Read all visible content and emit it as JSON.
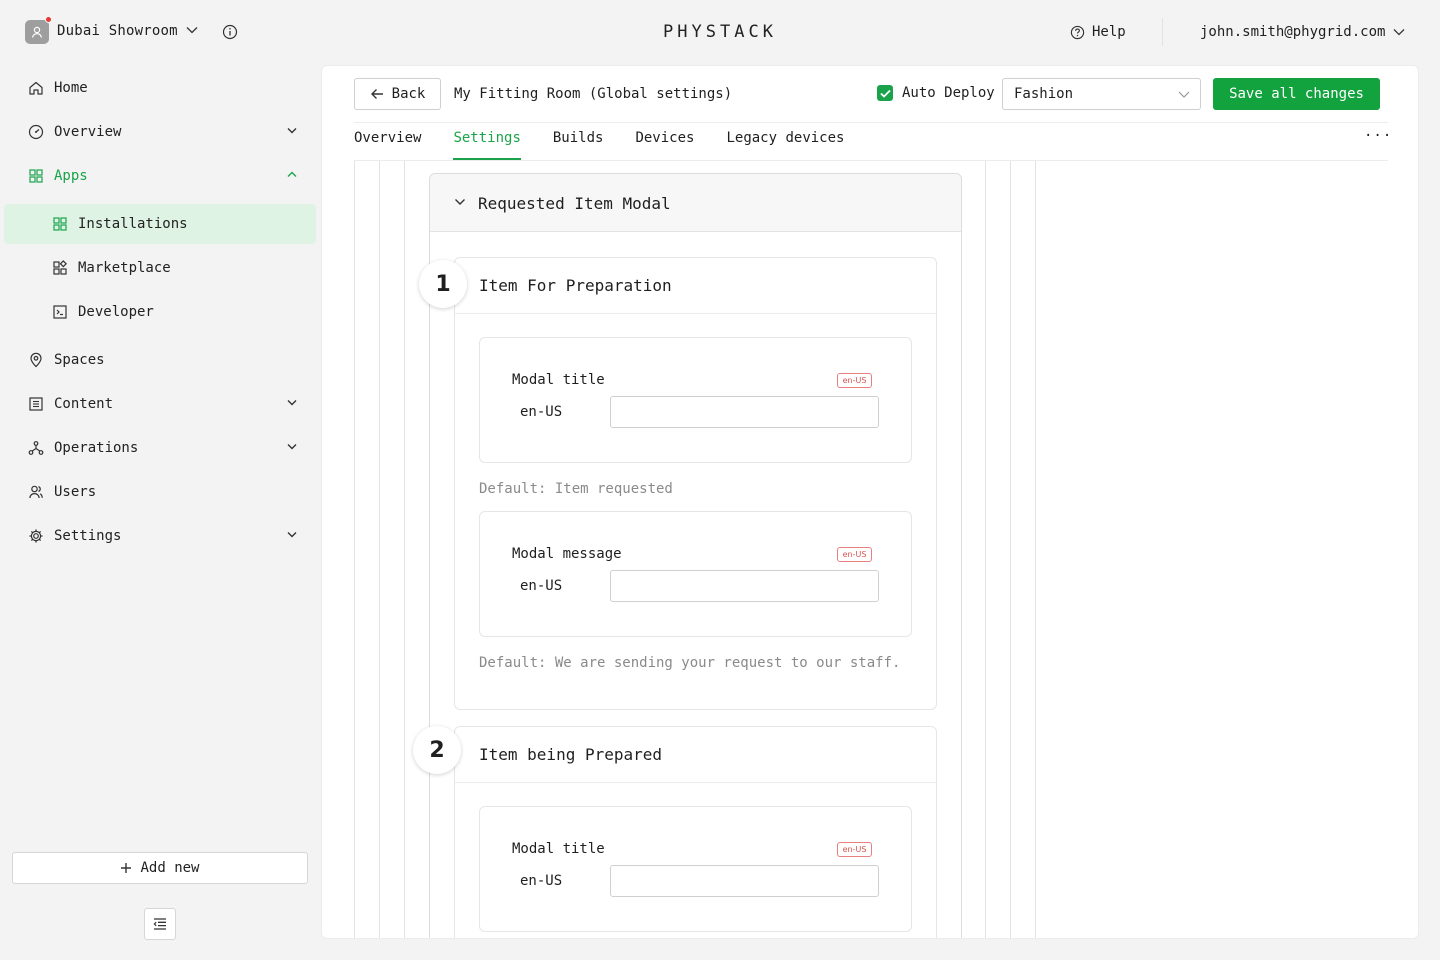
{
  "workspace": {
    "name": "Dubai Showroom"
  },
  "logo": "PHYSTACK",
  "header": {
    "help_label": "Help",
    "user_email": "john.smith@phygrid.com"
  },
  "sidebar": {
    "items": [
      {
        "label": "Home"
      },
      {
        "label": "Overview"
      },
      {
        "label": "Apps"
      },
      {
        "label": "Installations"
      },
      {
        "label": "Marketplace"
      },
      {
        "label": "Developer"
      },
      {
        "label": "Spaces"
      },
      {
        "label": "Content"
      },
      {
        "label": "Operations"
      },
      {
        "label": "Users"
      },
      {
        "label": "Settings"
      }
    ],
    "add_new_label": "Add new"
  },
  "toolbar": {
    "back_label": "Back",
    "title": "My Fitting Room (Global settings)",
    "auto_deploy_label": "Auto Deploy",
    "auto_deploy_checked": true,
    "select_value": "Fashion",
    "save_label": "Save all changes"
  },
  "tabs": [
    {
      "label": "Overview"
    },
    {
      "label": "Settings",
      "active": true
    },
    {
      "label": "Builds"
    },
    {
      "label": "Devices"
    },
    {
      "label": "Legacy devices"
    }
  ],
  "tabs_more": "···",
  "section": {
    "title": "Requested Item Modal",
    "steps": [
      {
        "number": "1",
        "title": "Item For Preparation",
        "fields": [
          {
            "label": "Modal title",
            "locale_badge": "en-US",
            "locale": "en-US",
            "value": "",
            "default": "Default: Item requested"
          },
          {
            "label": "Modal message",
            "locale_badge": "en-US",
            "locale": "en-US",
            "value": "",
            "default": "Default: We are sending your request to our staff."
          }
        ]
      },
      {
        "number": "2",
        "title": "Item being Prepared",
        "fields": [
          {
            "label": "Modal title",
            "locale_badge": "en-US",
            "locale": "en-US",
            "value": ""
          }
        ]
      }
    ]
  },
  "colors": {
    "accent": "#1aa34a",
    "accent_bg": "#dff3e4",
    "badge": "#d9534f"
  }
}
